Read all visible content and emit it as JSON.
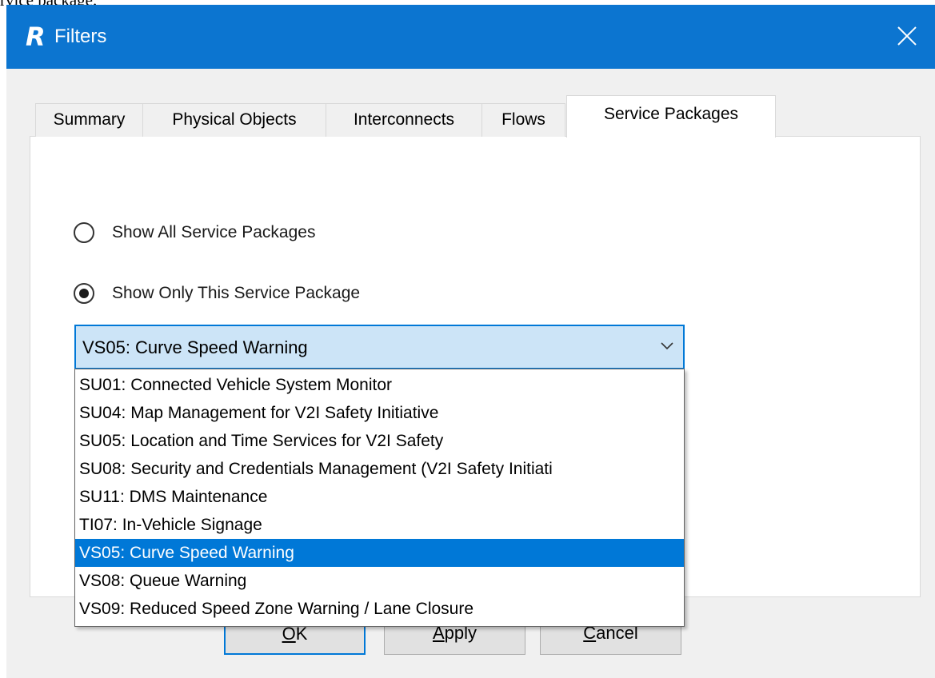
{
  "page": {
    "background_text": "rvice package."
  },
  "window": {
    "title": "Filters",
    "app_icon_letter": "R",
    "titlebar_color": "#0c75d0",
    "accent_color": "#0078d7"
  },
  "tabs": [
    {
      "label": "Summary",
      "active": false
    },
    {
      "label": "Physical Objects",
      "active": false
    },
    {
      "label": "Interconnects",
      "active": false
    },
    {
      "label": "Flows",
      "active": false
    },
    {
      "label": "Service Packages",
      "active": true
    }
  ],
  "filter": {
    "option_all": {
      "label": "Show All Service Packages",
      "checked": false
    },
    "option_only": {
      "label": "Show Only This Service Package",
      "checked": true
    }
  },
  "combo": {
    "selected_value": "VS05: Curve Speed Warning",
    "options": [
      "SU01: Connected Vehicle System Monitor",
      "SU04: Map Management for V2I Safety Initiative",
      "SU05: Location and Time Services for V2I Safety",
      "SU08: Security and Credentials Management (V2I Safety Initiati",
      "SU11: DMS Maintenance",
      "TI07: In-Vehicle Signage",
      "VS05: Curve Speed Warning",
      "VS08: Queue Warning",
      "VS09: Reduced Speed Zone Warning / Lane Closure"
    ],
    "highlighted_index": 6
  },
  "buttons": {
    "ok": {
      "mnemonic": "O",
      "rest": "K"
    },
    "apply": {
      "mnemonic": "A",
      "rest": "pply"
    },
    "cancel": {
      "mnemonic": "C",
      "rest": "ancel"
    }
  }
}
